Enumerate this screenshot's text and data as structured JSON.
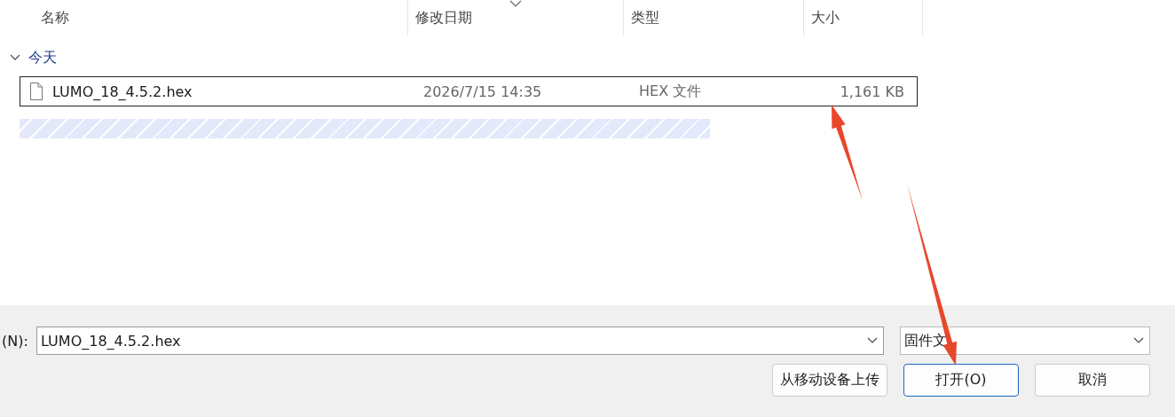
{
  "columns": [
    {
      "label": "名称",
      "sorted": false
    },
    {
      "label": "修改日期",
      "sorted": true
    },
    {
      "label": "类型",
      "sorted": false
    },
    {
      "label": "大小",
      "sorted": false
    }
  ],
  "groups": [
    {
      "label": "今天",
      "expanded": true,
      "files": [
        {
          "name": "LUMO_18_4.5.2.hex",
          "date": "2026/7/15 14:35",
          "type": "HEX 文件",
          "size": "1,161 KB",
          "selected": true
        }
      ]
    }
  ],
  "loading": {
    "kind": "striped"
  },
  "filename": {
    "label": "(N):",
    "value": "LUMO_18_4.5.2.hex"
  },
  "filter": {
    "value": "固件文"
  },
  "buttons": [
    {
      "label": "从移动设备上传",
      "kind": "normal"
    },
    {
      "label": "打开(O)",
      "kind": "default"
    },
    {
      "label": "取消",
      "kind": "normal"
    }
  ],
  "annotations": [
    {
      "kind": "arrow"
    },
    {
      "kind": "arrow"
    }
  ]
}
